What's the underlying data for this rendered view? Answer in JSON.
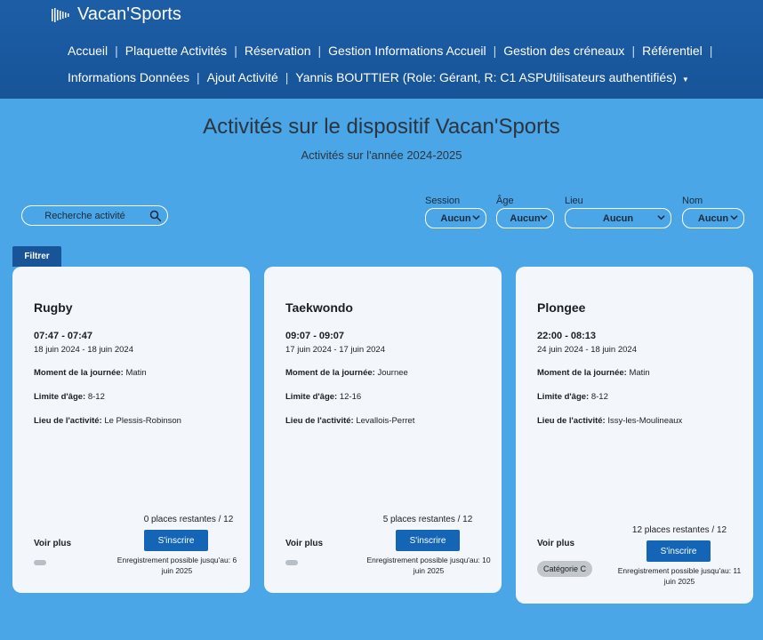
{
  "brand": {
    "name": "Vacan'Sports",
    "logo_icon": "wave-bars-logo"
  },
  "nav": {
    "row1": [
      "Accueil",
      "Plaquette Activités",
      "Réservation",
      "Gestion Informations Accueil",
      "Gestion des créneaux",
      "Référentiel"
    ],
    "row2": [
      "Informations Données",
      "Ajout Activité",
      "Yannis BOUTTIER (Role: Gérant, R: C1 ASPUtilisateurs authentifiés)"
    ]
  },
  "page": {
    "title": "Activités sur le dispositif Vacan'Sports",
    "subtitle": "Activités sur l'année 2024-2025"
  },
  "search": {
    "label": "Recherche activité",
    "icon": "search-icon"
  },
  "filters": {
    "session": {
      "label": "Session",
      "value": "Aucun"
    },
    "age": {
      "label": "Âge",
      "value": "Aucun"
    },
    "lieu": {
      "label": "Lieu",
      "value": "Aucun"
    },
    "nom": {
      "label": "Nom",
      "value": "Aucun"
    },
    "button": "Filtrer"
  },
  "cards": [
    {
      "name": "Rugby",
      "time": "07:47 - 07:47",
      "dates": "18 juin 2024 - 18 juin 2024",
      "moment_label": "Moment de la journée:",
      "moment": "Matin",
      "age_label": "Limite d'âge:",
      "age": "8-12",
      "lieu_label": "Lieu de l'activité:",
      "lieu": "Le Plessis-Robinson",
      "places": "0 places restantes / 12",
      "voir_plus": "Voir plus",
      "button": "S'inscrire",
      "deadline": "Enregistrement possible jusqu'au: 6 juin 2025"
    },
    {
      "name": "Taekwondo",
      "time": "09:07 - 09:07",
      "dates": "17 juin 2024 - 17 juin 2024",
      "moment_label": "Moment de la journée:",
      "moment": "Journee",
      "age_label": "Limite d'âge:",
      "age": "12-16",
      "lieu_label": "Lieu de l'activité:",
      "lieu": "Levallois-Perret",
      "places": "5 places restantes / 12",
      "voir_plus": "Voir plus",
      "button": "S'inscrire",
      "deadline": "Enregistrement possible jusqu'au: 10 juin 2025"
    },
    {
      "name": "Plongee",
      "time": "22:00 - 08:13",
      "dates": "24 juin 2024 - 18 juin 2024",
      "moment_label": "Moment de la journée:",
      "moment": "Matin",
      "age_label": "Limite d'âge:",
      "age": "8-12",
      "lieu_label": "Lieu de l'activité:",
      "lieu": "Issy-les-Moulineaux",
      "places": "12 places restantes / 12",
      "voir_plus": "Voir plus",
      "button": "S'inscrire",
      "category": "Catégorie C",
      "deadline": "Enregistrement possible jusqu'au: 11 juin 2025"
    }
  ],
  "colors": {
    "header": "#175498",
    "background": "#4aa6e6",
    "button": "#1565b6",
    "card": "#f3f7fb"
  }
}
